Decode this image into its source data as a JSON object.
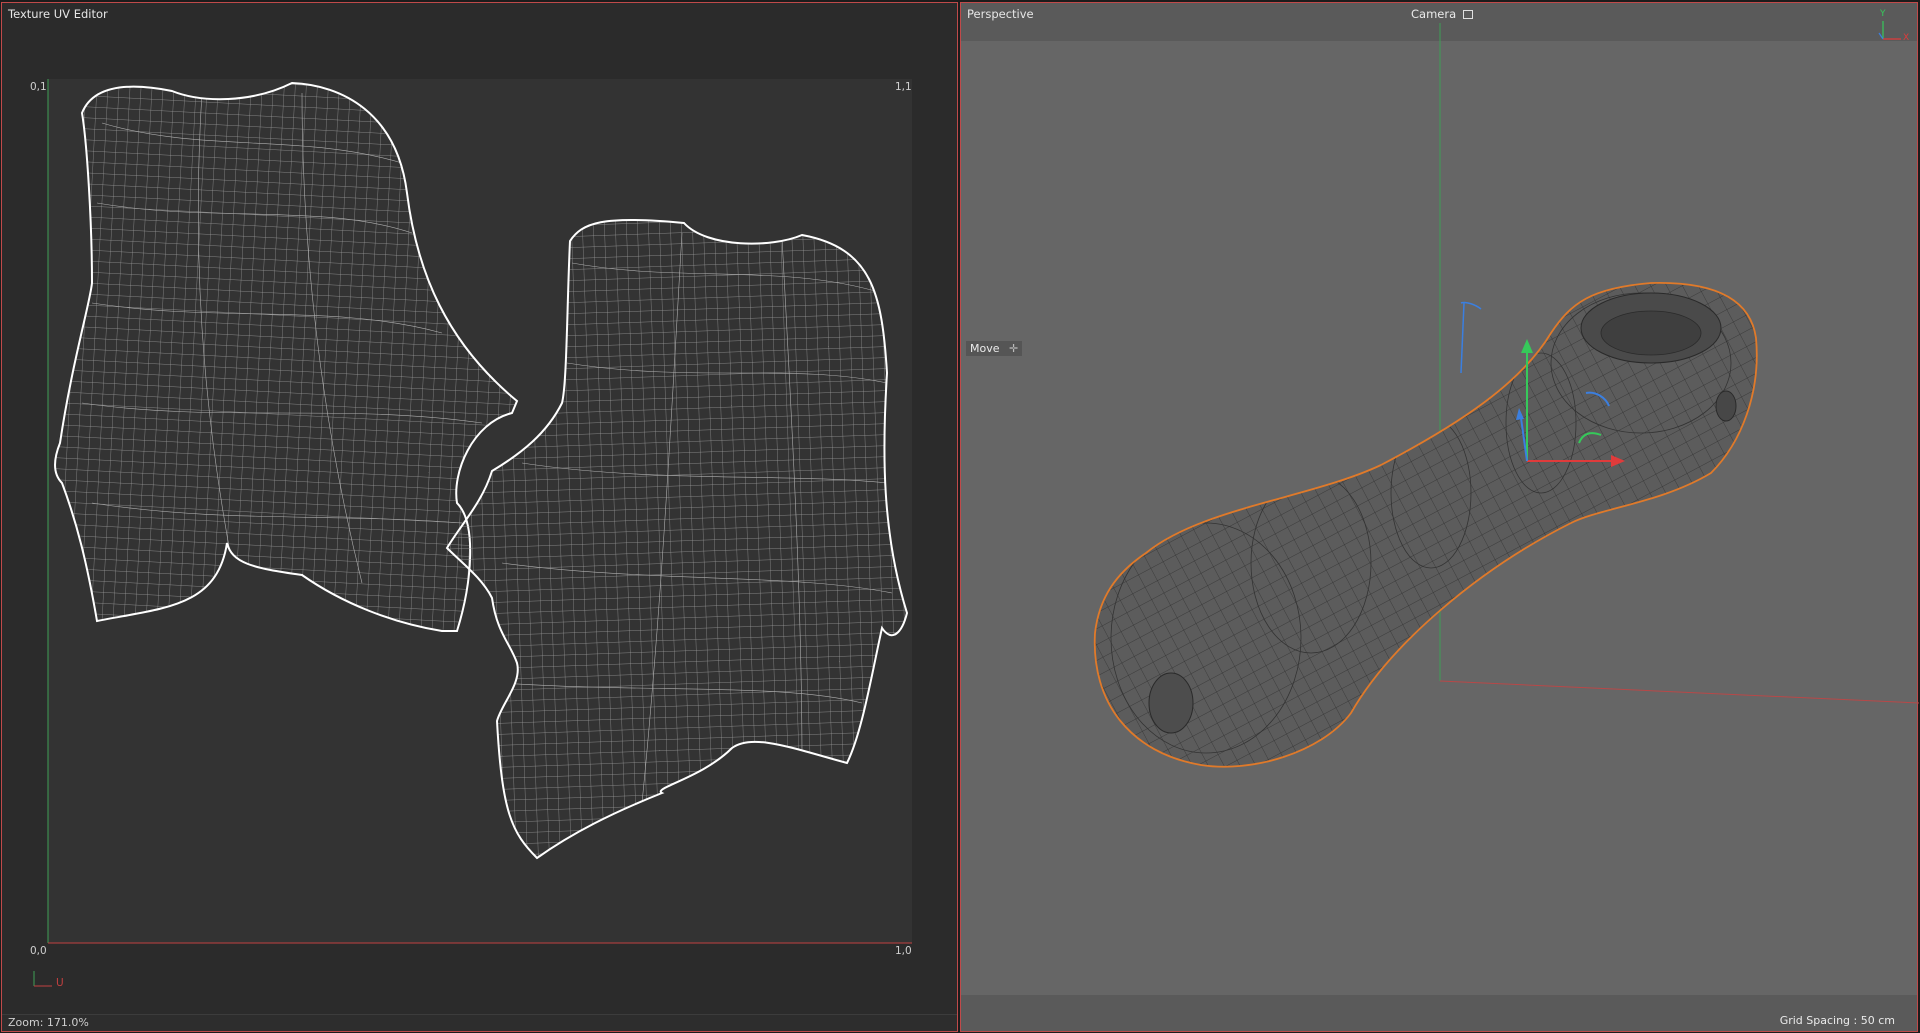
{
  "uv_editor": {
    "title": "Texture UV Editor",
    "corner_labels": {
      "top_left": "0,1",
      "top_right": "1,1",
      "bottom_left": "0,0",
      "bottom_right": "1,0"
    },
    "axis_u_label": "U",
    "zoom_text": "Zoom: 171.0%",
    "colors": {
      "background": "#2b2b2b",
      "uv_square": "#333333",
      "mesh": "#bdbdbd",
      "border": "#ffffff",
      "v_axis": "#3f9f55",
      "u_axis": "#c04040"
    }
  },
  "viewport": {
    "title": "Perspective",
    "camera_menu": "Camera",
    "tool_label": "Move",
    "grid_spacing": "Grid Spacing : 50 cm",
    "axis_gizmo": {
      "x": "X",
      "y": "Y"
    },
    "colors": {
      "background": "#666666",
      "selection_outline": "#e07a2a",
      "axis_x": "#e03b3b",
      "axis_y": "#36c95a",
      "axis_z": "#3b7fe0"
    }
  },
  "icons": [
    "camera-lock-icon",
    "move-tool-icon",
    "axis-gizmo-icon",
    "uv-axis-icon"
  ]
}
